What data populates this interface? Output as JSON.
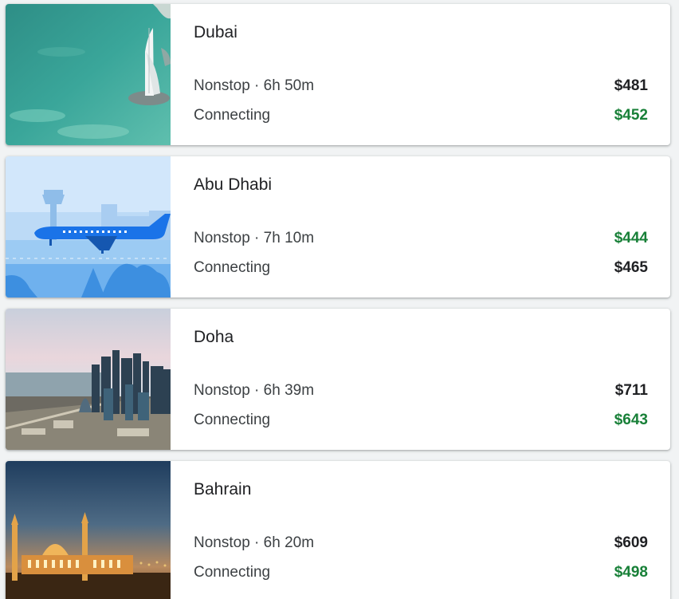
{
  "colors": {
    "accent_low_price": "#188038",
    "text_primary": "#202124",
    "text_secondary": "#3c4043"
  },
  "destinations": [
    {
      "name": "Dubai",
      "image_icon": "burj-al-arab-photo",
      "nonstop_label": "Nonstop · 6h 50m",
      "nonstop_price": "$481",
      "connecting_label": "Connecting",
      "connecting_price": "$452",
      "cheapest": "connecting"
    },
    {
      "name": "Abu Dhabi",
      "image_icon": "airplane-illustration",
      "nonstop_label": "Nonstop · 7h 10m",
      "nonstop_price": "$444",
      "connecting_label": "Connecting",
      "connecting_price": "$465",
      "cheapest": "nonstop"
    },
    {
      "name": "Doha",
      "image_icon": "doha-skyline-photo",
      "nonstop_label": "Nonstop · 6h 39m",
      "nonstop_price": "$711",
      "connecting_label": "Connecting",
      "connecting_price": "$643",
      "cheapest": "connecting"
    },
    {
      "name": "Bahrain",
      "image_icon": "bahrain-mosque-photo",
      "nonstop_label": "Nonstop · 6h 20m",
      "nonstop_price": "$609",
      "connecting_label": "Connecting",
      "connecting_price": "$498",
      "cheapest": "connecting"
    }
  ]
}
